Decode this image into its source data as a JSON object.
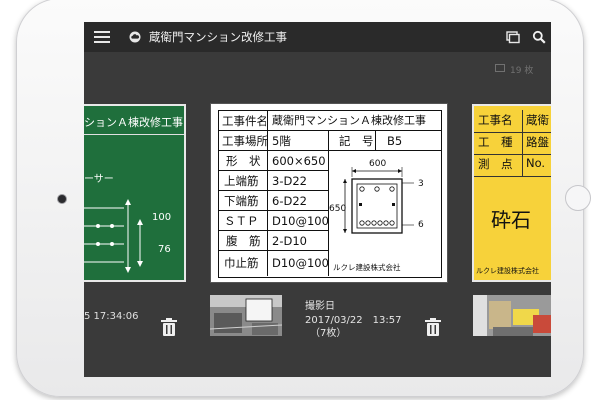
{
  "app": {
    "title": "蔵衛門マンション改修工事",
    "photo_count": "19 枚"
  },
  "icons": {
    "menu": "hamburger-menu-icon",
    "cloud": "cloud-icon",
    "gallery": "gallery-icon",
    "search": "search-icon",
    "trash": "trash-icon"
  },
  "left_board": {
    "title": "ションＡ棟改修工事",
    "label": "ーサー",
    "dim1": "100",
    "dim2": "76"
  },
  "center_board": {
    "rows": [
      {
        "label": "工事件名",
        "value": "蔵衛門マンションＡ棟改修工事"
      },
      {
        "label": "工事場所",
        "value": "5階",
        "label2": "記　号",
        "value2": "B5"
      },
      {
        "label": "形　状",
        "value": "600×650"
      },
      {
        "label": "上端筋",
        "value": "3-D22"
      },
      {
        "label": "下端筋",
        "value": "6-D22"
      },
      {
        "label": "ＳＴＰ",
        "value": "D10@100"
      },
      {
        "label": "腹　筋",
        "value": "2-D10"
      },
      {
        "label": "巾止筋",
        "value": "D10@100"
      }
    ],
    "diagram": {
      "width_label": "600",
      "height_label": "650",
      "top_bars": "3",
      "bottom_bars": "6"
    },
    "company": "ルクレ建設株式会社"
  },
  "right_board": {
    "rows": [
      {
        "label": "工事名",
        "value": "蔵衛"
      },
      {
        "label": "工　種",
        "value": "路盤"
      },
      {
        "label": "測　点",
        "value": "No."
      }
    ],
    "big_text": "砕石",
    "company": "ルクレ建設株式会社"
  },
  "strip": {
    "left_time": "5 17:34:06",
    "center": {
      "label": "撮影日",
      "datetime": "2017/03/22　13:57",
      "count": "（7枚）"
    }
  },
  "colors": {
    "appbar": "#2a2a2a",
    "screen_bg": "#3a3a3a",
    "board_green": "#1f6f3c",
    "board_yellow": "#f7d23a"
  }
}
